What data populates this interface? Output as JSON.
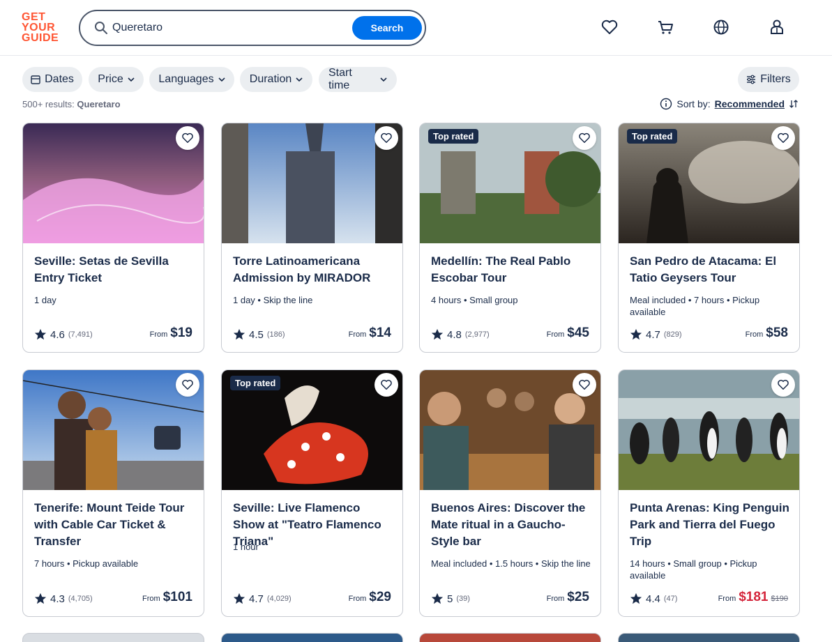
{
  "header": {
    "logo": [
      "GET",
      "YOUR",
      "GUIDE"
    ],
    "search_value": "Queretaro",
    "search_button": "Search",
    "icons": [
      "heart-icon",
      "cart-icon",
      "globe-icon",
      "profile-icon"
    ]
  },
  "filters": {
    "chips": [
      "Dates",
      "Price",
      "Languages",
      "Duration",
      "Start time"
    ],
    "filters_button": "Filters"
  },
  "results": {
    "count": "500+ results:",
    "query": "Queretaro"
  },
  "sort": {
    "label": "Sort by:",
    "value": "Recommended"
  },
  "cards": [
    {
      "title": "Seville: Setas de Sevilla Entry Ticket",
      "meta": "1 day",
      "rating": "4.6",
      "count": "(7,491)",
      "from": "From",
      "price": "$19",
      "badge": ""
    },
    {
      "title": "Torre Latinoamericana Admission by MIRADOR",
      "meta": "1 day • Skip the line",
      "rating": "4.5",
      "count": "(186)",
      "from": "From",
      "price": "$14",
      "badge": ""
    },
    {
      "title": "Medellín: The Real Pablo Escobar Tour",
      "meta": "4 hours • Small group",
      "rating": "4.8",
      "count": "(2,977)",
      "from": "From",
      "price": "$45",
      "badge": "Top rated"
    },
    {
      "title": "San Pedro de Atacama: El Tatio Geysers Tour",
      "meta": "Meal included • 7 hours • Pickup available",
      "rating": "4.7",
      "count": "(829)",
      "from": "From",
      "price": "$58",
      "badge": "Top rated"
    },
    {
      "title": "Tenerife: Mount Teide Tour with Cable Car Ticket & Transfer",
      "meta": "7 hours • Pickup available",
      "rating": "4.3",
      "count": "(4,705)",
      "from": "From",
      "price": "$101",
      "badge": ""
    },
    {
      "title": "Seville: Live Flamenco Show at \"Teatro Flamenco Triana\"",
      "meta": "1 hour",
      "rating": "4.7",
      "count": "(4,029)",
      "from": "From",
      "price": "$29",
      "badge": "Top rated"
    },
    {
      "title": "Buenos Aires: Discover the Mate ritual in a Gaucho-Style bar",
      "meta": "Meal included • 1.5 hours • Skip the line",
      "rating": "5",
      "count": "(39)",
      "from": "From",
      "price": "$25",
      "badge": ""
    },
    {
      "title": "Punta Arenas: King Penguin Park and Tierra del Fuego Trip",
      "meta": "14 hours • Small group • Pickup available",
      "rating": "4.4",
      "count": "(47)",
      "from": "From",
      "price": "$181",
      "old_price": "$190",
      "badge": ""
    }
  ]
}
